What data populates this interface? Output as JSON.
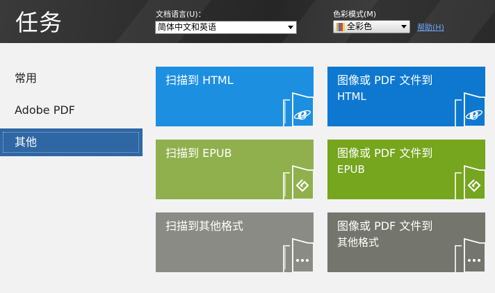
{
  "header": {
    "title": "任务",
    "language_label": "文档语言(U)：",
    "language_value": "简体中文和英语",
    "color_mode_label": "色彩模式(M)",
    "color_mode_value": "全彩色",
    "help_label": "帮助(H)"
  },
  "sidebar": {
    "items": [
      {
        "label": "常用"
      },
      {
        "label": "Adobe PDF"
      },
      {
        "label": "其他"
      }
    ],
    "active": "其他"
  },
  "tiles": [
    {
      "line1": "扫描到 HTML",
      "line2": "",
      "icon": "html-ie-icon",
      "color": "#1d8fe0"
    },
    {
      "line1": "图像或 PDF 文件到",
      "line2": "HTML",
      "icon": "html-ie-icon",
      "color": "#0e78d0"
    },
    {
      "line1": "扫描到 EPUB",
      "line2": "",
      "icon": "epub-icon",
      "color": "#8fb04c"
    },
    {
      "line1": "图像或 PDF 文件到",
      "line2": "EPUB",
      "icon": "epub-icon",
      "color": "#76a51e"
    },
    {
      "line1": "扫描到其他格式",
      "line2": "",
      "icon": "ellipsis-icon",
      "color": "#8a8b84"
    },
    {
      "line1": "图像或 PDF 文件到",
      "line2": "其他格式",
      "icon": "ellipsis-icon",
      "color": "#74766e"
    }
  ]
}
